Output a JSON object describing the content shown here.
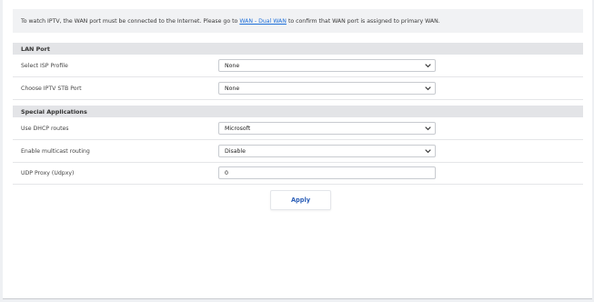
{
  "notice": {
    "text_before": "To watch IPTV, the WAN port must be connected to the Internet. Please go to",
    "link_text": "WAN - Dual WAN",
    "text_after": "to confirm that WAN port is assigned to primary WAN."
  },
  "lan_port": {
    "title": "LAN Port",
    "isp_profile": {
      "label": "Select ISP Profile",
      "value": "None"
    },
    "stb_port": {
      "label": "Choose IPTV STB Port",
      "value": "None"
    }
  },
  "special": {
    "title": "Special Applications",
    "dhcp_routes": {
      "label": "Use DHCP routes",
      "value": "Microsoft"
    },
    "multicast": {
      "label": "Enable multicast routing",
      "value": "Disable"
    },
    "udp_proxy": {
      "label": "UDP Proxy (Udpxy)",
      "value": "0"
    }
  },
  "actions": {
    "apply_label": "Apply"
  },
  "icons": {
    "dropdown": "chevron-down-icon"
  },
  "colors": {
    "link": "#1e6fd9",
    "apply_text": "#2c5fb8",
    "section_bg": "#e3e4e7"
  }
}
